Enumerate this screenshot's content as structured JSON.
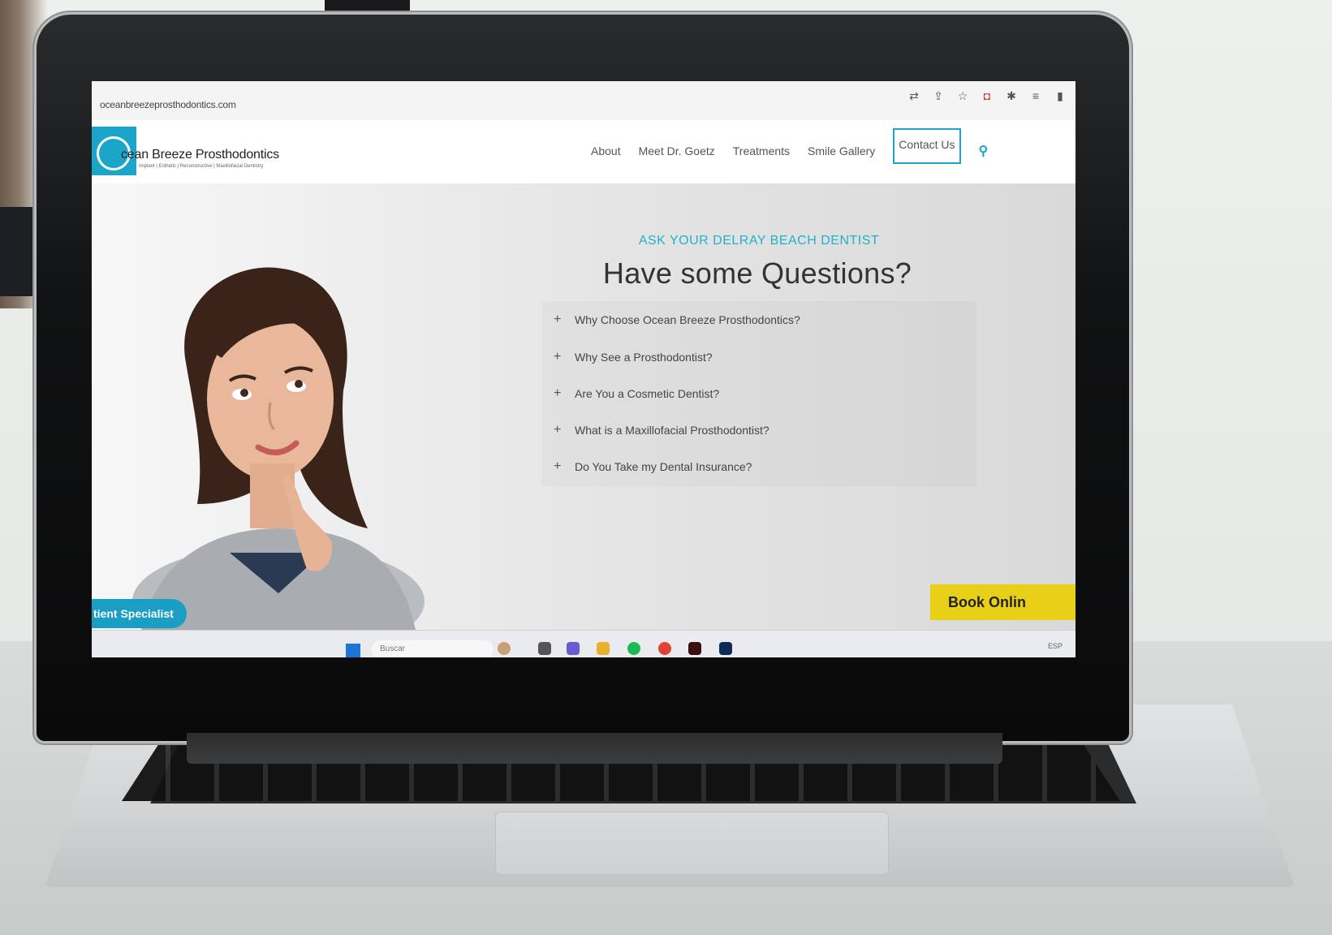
{
  "browser": {
    "url": "oceanbreezeprosthodontics.com"
  },
  "site": {
    "logo_name": "cean Breeze Prosthodontics",
    "logo_tag": "Implant | Esthetic | Reconstructive | Maxillofacial Dentistry",
    "nav": {
      "about": "About",
      "meet": "Meet Dr. Goetz",
      "treatments": "Treatments",
      "gallery": "Smile Gallery",
      "contact": "Contact Us"
    },
    "kicker": "ASK YOUR DELRAY BEACH DENTIST",
    "heading": "Have some Questions?",
    "faq": [
      "Why Choose Ocean Breeze Prosthodontics?",
      "Why See a Prosthodontist?",
      "Are You a Cosmetic Dentist?",
      "What is a Maxillofacial Prosthodontist?",
      "Do You Take my Dental Insurance?"
    ],
    "cta_left": "tient Specialist",
    "cta_right": "Book Onlin"
  },
  "taskbar": {
    "search_placeholder": "Buscar",
    "tray": "ESP"
  },
  "colors": {
    "accent": "#1ba6c9",
    "cta_yellow": "#e8d018"
  }
}
